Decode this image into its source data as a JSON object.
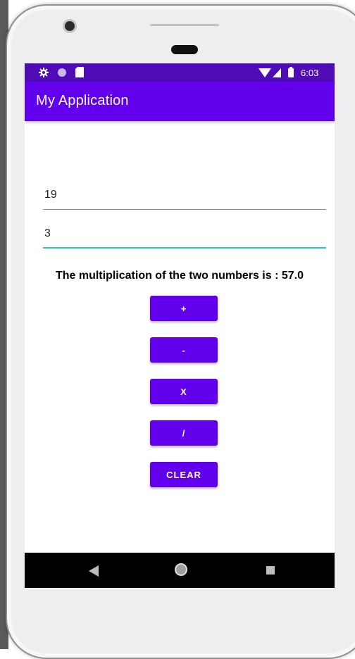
{
  "app": {
    "title": "My Application"
  },
  "status_bar": {
    "time": "6:03"
  },
  "inputs": {
    "first_number": "19",
    "second_number": "3"
  },
  "result_text": "The multiplication of the two numbers is : 57.0",
  "buttons": {
    "add": "+",
    "subtract": "-",
    "multiply": "X",
    "divide": "/",
    "clear": "CLEAR"
  },
  "colors": {
    "primary": "#6200ee",
    "status_bar": "#4f0bb6",
    "focus_underline": "#1ec9be"
  },
  "icons": {
    "status_left": [
      "gear-icon",
      "circle-icon",
      "sd-card-icon"
    ],
    "status_right": [
      "wifi-icon",
      "signal-icon",
      "battery-icon"
    ],
    "nav": [
      "back-icon",
      "home-icon",
      "recents-icon"
    ]
  }
}
